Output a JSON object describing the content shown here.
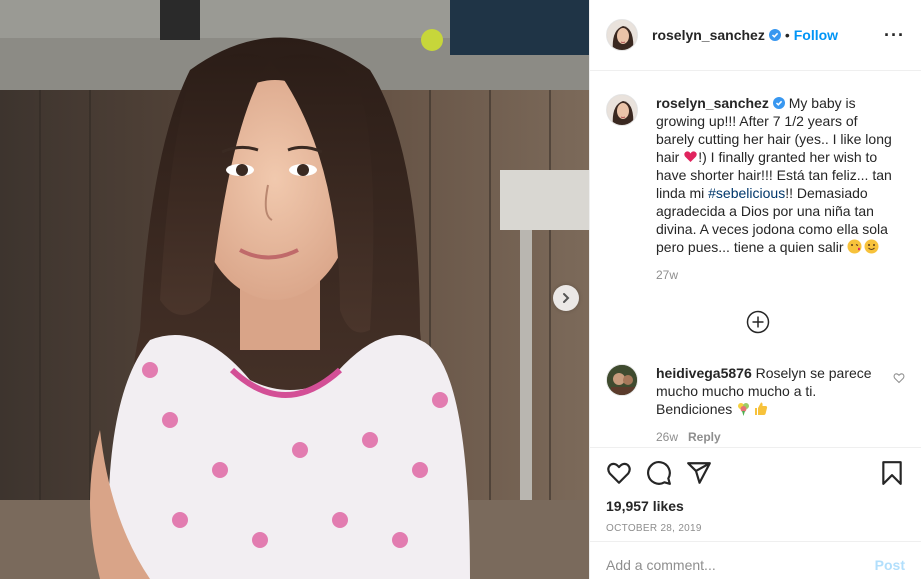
{
  "post": {
    "username": "roselyn_sanchez",
    "follow_label": "Follow",
    "more_icon": "more-options-icon",
    "next_icon": "chevron-right-icon"
  },
  "caption": {
    "username": "roselyn_sanchez",
    "text_1": "My baby is growing up!!! After 7 1/2 years of barely cutting her hair (yes.. I like long hair ",
    "text_2": "!) I finally granted her wish to have shorter hair!!! Está tan feliz... tan linda mi ",
    "hashtag": "#sebelicious",
    "text_3": "!! Demasiado agradecida a Dios por una niña tan divina. A veces jodona como ella sola pero pues... tiene a quien salir ",
    "time": "27w"
  },
  "comment": {
    "username": "heidivega5876",
    "text": "Roselyn se parece mucho mucho mucho a ti. Bendiciones ",
    "time": "26w",
    "reply_label": "Reply"
  },
  "actions": {
    "likes": "19,957 likes",
    "date": "October 28, 2019"
  },
  "add_comment": {
    "placeholder": "Add a comment...",
    "post_label": "Post"
  },
  "colors": {
    "accent": "#0095f6",
    "hashtag": "#00376b",
    "muted": "#8e8e8e",
    "post_disabled": "#b2dffc"
  }
}
